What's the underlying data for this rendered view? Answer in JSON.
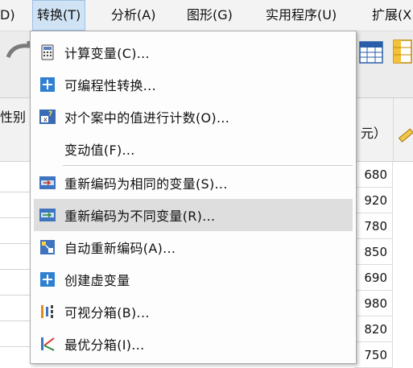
{
  "menubar": {
    "items": [
      {
        "label": "D)"
      },
      {
        "label": "转换(T)"
      },
      {
        "label": "分析(A)"
      },
      {
        "label": "图形(G)"
      },
      {
        "label": "实用程序(U)"
      },
      {
        "label": "扩展(X"
      }
    ]
  },
  "grid": {
    "left_header": "性别",
    "right_header": "元）",
    "values": [
      "680",
      "920",
      "780",
      "850",
      "690",
      "980",
      "820",
      "750"
    ]
  },
  "menu": {
    "items": [
      {
        "label": "计算变量(C)...",
        "icon": "calculator-icon"
      },
      {
        "label": "可编程性转换...",
        "icon": "plus-icon"
      },
      {
        "label": "对个案中的值进行计数(O)...",
        "icon": "count-values-icon"
      },
      {
        "label": "变动值(F)...",
        "icon": ""
      },
      {
        "label": "重新编码为相同的变量(S)...",
        "icon": "recode-same-icon"
      },
      {
        "label": "重新编码为不同变量(R)...",
        "icon": "recode-different-icon"
      },
      {
        "label": "自动重新编码(A)...",
        "icon": "auto-recode-icon"
      },
      {
        "label": "创建虚变量",
        "icon": "plus-icon"
      },
      {
        "label": "可视分箱(B)...",
        "icon": "visual-binning-icon"
      },
      {
        "label": "最优分箱(I)...",
        "icon": "optimal-binning-icon"
      }
    ]
  }
}
